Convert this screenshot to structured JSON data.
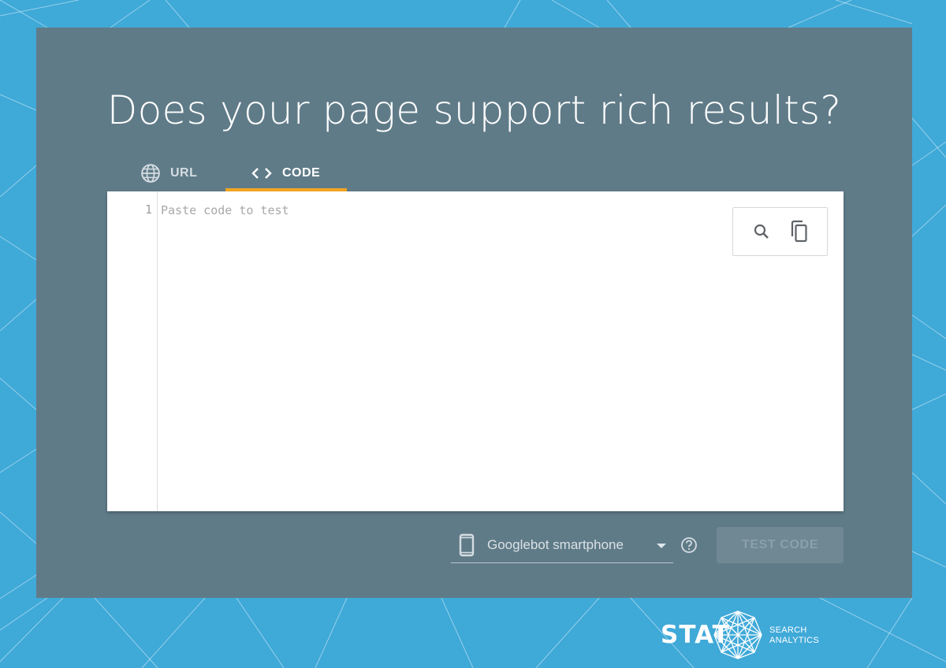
{
  "heading": "Does your page support rich results?",
  "tabs": {
    "url_label": "URL",
    "code_label": "CODE",
    "active": "code"
  },
  "editor": {
    "line_number": "1",
    "placeholder": "Paste code to test",
    "value": ""
  },
  "device": {
    "selected": "Googlebot smartphone"
  },
  "test_button_label": "TEST CODE",
  "brand": {
    "name": "STAT",
    "subtitle_line1": "SEARCH",
    "subtitle_line2": "ANALYTICS"
  },
  "colors": {
    "background": "#3fa9d8",
    "panel": "#607b88",
    "tab_indicator": "#f5a623"
  },
  "icons": [
    "globe-icon",
    "code-icon",
    "search-icon",
    "copy-icon",
    "smartphone-icon",
    "arrow-drop-down-icon",
    "help-icon"
  ]
}
